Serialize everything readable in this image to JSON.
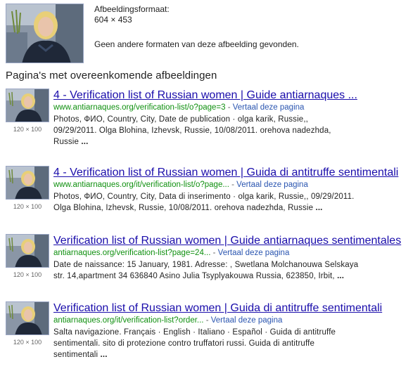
{
  "image_info": {
    "format_label": "Afbeeldingsformaat:",
    "dimensions": "604 × 453",
    "other_sizes_text": "Geen andere formaten van deze afbeelding gevonden."
  },
  "section_title": "Pagina's met overeenkomende afbeeldingen",
  "results": [
    {
      "title": "4 - Verification list of Russian women | Guide antiarnaques ...",
      "url": "www.antiarnaques.org/verification-list/o?page=3",
      "separator": " - ",
      "translate_label": "Vertaal deze pagina",
      "snippet_line1": "Photos, ФИО, Country, City, Date de publication · olga karik, Russie,,",
      "snippet_line2": "09/29/2011. Olga Blohina, Izhevsk, Russie, 10/08/2011. orehova nadezhda,",
      "snippet_line3_text": "Russie ",
      "ellipsis": "...",
      "thumb_size": "120 × 100"
    },
    {
      "title": "4 - Verification list of Russian women | Guida di antitruffe sentimentali",
      "url": "www.antiarnaques.org/it/verification-list/o?page...",
      "separator": " - ",
      "translate_label": "Vertaal deze pagina",
      "snippet_line1": "Photos, ФИО, Country, City, Data di inserimento · olga karik, Russie,, 09/29/2011.",
      "snippet_line2_text": "Olga Blohina, Izhevsk, Russie, 10/08/2011. orehova nadezhda, Russie ",
      "ellipsis": "...",
      "thumb_size": "120 × 100"
    },
    {
      "title": "Verification list of Russian women | Guide antiarnaques sentimentales",
      "url": "antiarnaques.org/verification-list?page=24...",
      "separator": " - ",
      "translate_label": "Vertaal deze pagina",
      "snippet_line1": "Date de naissance: 15 January, 1981. Adresse: , Swetlana Molchanouwa Selskaya",
      "snippet_line2_text": "str. 14,apartment 34 636840 Asino Julia Tsyplyakouwa Russia, 623850, Irbit, ",
      "ellipsis": "...",
      "thumb_size": "120 × 100"
    },
    {
      "title": "Verification list of Russian women | Guida di antitruffe sentimentali",
      "url": "antiarnaques.org/it/verification-list?order...",
      "separator": " - ",
      "translate_label": "Vertaal deze pagina",
      "snippet_line1": "Salta navigazione. Français · English · Italiano · Español · Guida di antitruffe",
      "snippet_line2": "sentimentali. sito di protezione contro truffatori russi. Guida di antitruffe",
      "snippet_line3_text": "sentimentali ",
      "ellipsis": "...",
      "thumb_size": "120 × 100"
    }
  ],
  "colors": {
    "link": "#1a0dab",
    "url_green": "#109010",
    "translate_blue": "#2a55b0",
    "thumb_border": "#9aa6c4"
  }
}
